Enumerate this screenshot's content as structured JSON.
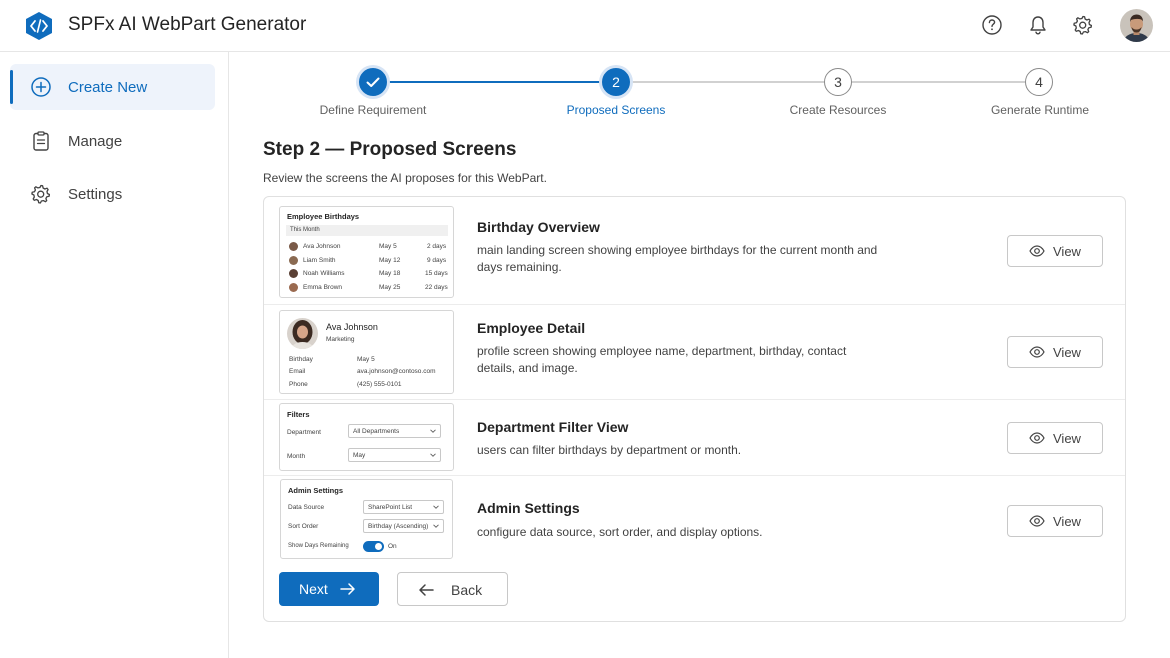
{
  "app": {
    "title": "SPFx AI WebPart Generator",
    "logo_icon": "code-hexagon-icon",
    "accent": "#0f6cbd"
  },
  "header": {
    "icons": [
      "help-icon",
      "bell-icon",
      "gear-icon"
    ],
    "avatar": "user-avatar"
  },
  "sidebar": {
    "items": [
      {
        "label": "Create New",
        "icon": "plus-circle-icon",
        "active": true
      },
      {
        "label": "Manage",
        "icon": "clipboard-icon",
        "active": false
      },
      {
        "label": "Settings",
        "icon": "gear-icon",
        "active": false
      }
    ]
  },
  "stepper": {
    "steps": [
      {
        "number": "1",
        "label": "Define Requirement",
        "state": "done"
      },
      {
        "number": "2",
        "label": "Proposed Screens",
        "state": "current"
      },
      {
        "number": "3",
        "label": "Create Resources",
        "state": "pending"
      },
      {
        "number": "4",
        "label": "Generate Runtime",
        "state": "pending"
      }
    ]
  },
  "page": {
    "title": "Step 2 — Proposed Screens",
    "subtitle": "Review the screens the AI proposes for this WebPart."
  },
  "screens": [
    {
      "title": "Birthday Overview",
      "description": "main landing screen showing employee birthdays for the current month and days remaining.",
      "view_label": "View",
      "preview": {
        "heading": "Employee Birthdays",
        "tab": "This Month",
        "rows": [
          {
            "name": "Ava Johnson",
            "date": "May 5",
            "days": "2 days"
          },
          {
            "name": "Liam Smith",
            "date": "May 12",
            "days": "9 days"
          },
          {
            "name": "Noah Williams",
            "date": "May 18",
            "days": "15 days"
          },
          {
            "name": "Emma Brown",
            "date": "May 25",
            "days": "22 days"
          }
        ]
      }
    },
    {
      "title": "Employee Detail",
      "description": "profile screen showing employee name, department, birthday, contact details, and image.",
      "view_label": "View",
      "preview": {
        "name": "Ava Johnson",
        "department": "Marketing",
        "fields": [
          {
            "label": "Birthday",
            "value": "May 5"
          },
          {
            "label": "Email",
            "value": "ava.johnson@contoso.com"
          },
          {
            "label": "Phone",
            "value": "(425) 555-0101"
          }
        ]
      }
    },
    {
      "title": "Department Filter View",
      "description": "users can filter birthdays by department or month.",
      "view_label": "View",
      "preview": {
        "heading": "Filters",
        "fields": [
          {
            "label": "Department",
            "value": "All Departments"
          },
          {
            "label": "Month",
            "value": "May"
          }
        ]
      }
    },
    {
      "title": "Admin Settings",
      "description": "configure data source, sort order, and display options.",
      "view_label": "View",
      "preview": {
        "heading": "Admin Settings",
        "fields": [
          {
            "label": "Data Source",
            "value": "SharePoint List"
          },
          {
            "label": "Sort Order",
            "value": "Birthday (Ascending)"
          }
        ],
        "toggle": {
          "label": "Show Days Remaining",
          "value": "On"
        }
      }
    }
  ],
  "actions": {
    "next_label": "Next",
    "back_label": "Back"
  }
}
